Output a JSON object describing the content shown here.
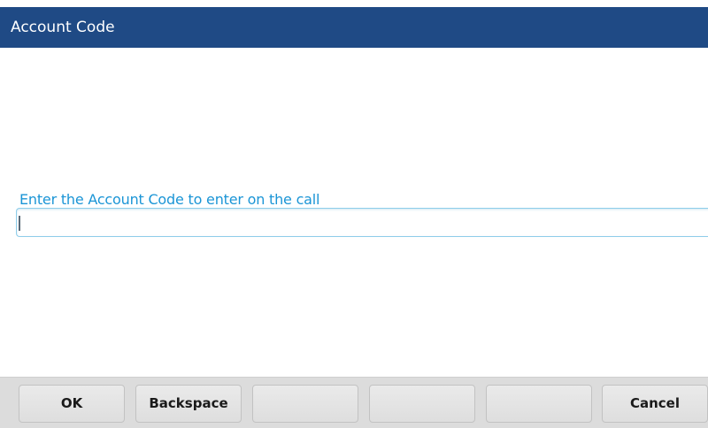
{
  "header": {
    "title": "Account Code"
  },
  "form": {
    "prompt": "Enter the Account Code to enter on the call",
    "account_code_value": ""
  },
  "softkeys": [
    {
      "label": "OK"
    },
    {
      "label": "Backspace"
    },
    {
      "label": ""
    },
    {
      "label": ""
    },
    {
      "label": ""
    },
    {
      "label": "Cancel"
    }
  ],
  "colors": {
    "title_bar": "#1f4a85",
    "prompt_text": "#1b95d6",
    "input_border": "#8ecdea",
    "softkey_bar": "#dcdcdc"
  }
}
